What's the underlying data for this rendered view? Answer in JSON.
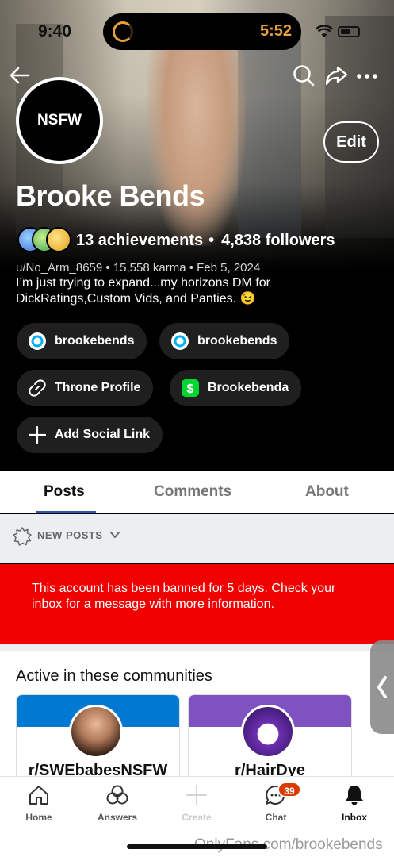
{
  "status_bar": {
    "time": "9:40",
    "timer": "5:52"
  },
  "header": {
    "back_icon": "arrow-left-icon",
    "search_icon": "search-icon",
    "share_icon": "share-icon",
    "more_icon": "more-icon"
  },
  "profile": {
    "avatar_text": "NSFW",
    "edit_label": "Edit",
    "display_name": "Brooke Bends",
    "achievements": "13 achievements",
    "separator": "•",
    "followers": "4,838 followers",
    "meta": "u/No_Arm_8659 • 15,558 karma • Feb 5, 2024",
    "bio": "I’m just trying to expand...my horizons DM for DickRatings,Custom Vids, and Panties. 😉"
  },
  "social_links": [
    {
      "label": "brookebends",
      "icon": "onlyfans-icon"
    },
    {
      "label": "brookebends",
      "icon": "onlyfans-icon"
    },
    {
      "label": "Throne Profile",
      "icon": "link-icon"
    },
    {
      "label": "Brookebenda",
      "icon": "cashapp-icon"
    },
    {
      "label": "Add Social Link",
      "icon": "plus-icon"
    }
  ],
  "tabs": [
    "Posts",
    "Comments",
    "About"
  ],
  "sort": {
    "label": "NEW POSTS"
  },
  "ban_notice": "This account has been banned for 5 days. Check your inbox for a message with more information.",
  "communities": {
    "title": "Active in these communities",
    "items": [
      {
        "name": "r/SWEbabesNSFW",
        "banner_color": "#0079d3"
      },
      {
        "name": "r/HairDye",
        "banner_color": "#7e53c1"
      }
    ]
  },
  "bottom_nav": [
    {
      "label": "Home",
      "icon": "home-icon"
    },
    {
      "label": "Answers",
      "icon": "answers-icon"
    },
    {
      "label": "Create",
      "icon": "plus-icon"
    },
    {
      "label": "Chat",
      "icon": "chat-icon",
      "badge": "39"
    },
    {
      "label": "Inbox",
      "icon": "bell-icon"
    }
  ],
  "watermark": "OnlyFans.com/brookebends"
}
